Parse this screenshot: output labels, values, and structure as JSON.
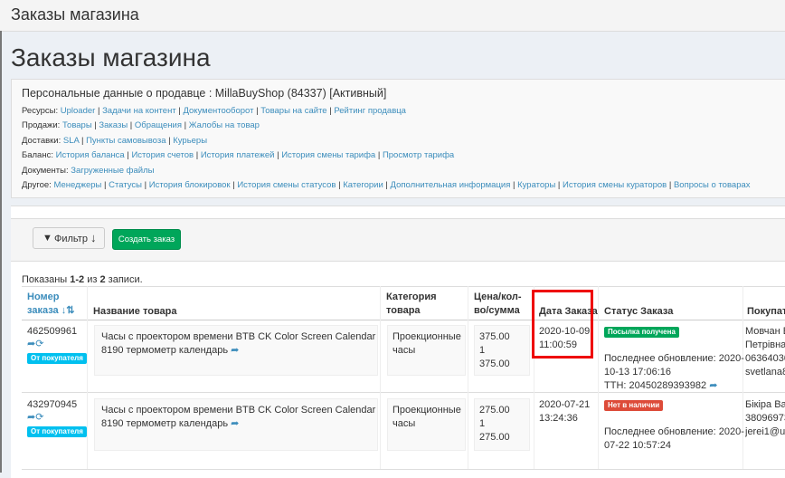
{
  "window": {
    "title": "Заказы магазина"
  },
  "page": {
    "heading": "Заказы магазина"
  },
  "seller": {
    "title": "Персональные данные о продавце : MillaBuyShop (84337) [Активный]"
  },
  "nav": [
    {
      "label": "Ресурсы:",
      "links": [
        "Uploader",
        "Задачи на контент",
        "Документооборот",
        "Товары на сайте",
        "Рейтинг продавца"
      ]
    },
    {
      "label": "Продажи:",
      "links": [
        "Товары",
        "Заказы",
        "Обращения",
        "Жалобы на товар"
      ]
    },
    {
      "label": "Доставки:",
      "links": [
        "SLA",
        "Пункты самовывоза",
        "Курьеры"
      ]
    },
    {
      "label": "Баланс:",
      "links": [
        "История баланса",
        "История счетов",
        "История платежей",
        "История смены тарифа",
        "Просмотр тарифа"
      ]
    },
    {
      "label": "Документы:",
      "links": [
        "Загруженные файлы"
      ]
    },
    {
      "label": "Другое:",
      "links": [
        "Менеджеры",
        "Статусы",
        "История блокировок",
        "История смены статусов",
        "Категории",
        "Дополнительная информация",
        "Кураторы",
        "История смены кураторов",
        "Вопросы о товарах"
      ]
    }
  ],
  "toolbar": {
    "filter_label": "Фильтр",
    "create_label": "Создать заказ"
  },
  "summary": {
    "prefix": "Показаны ",
    "range": "1-2",
    "mid": " из ",
    "total": "2",
    "suffix": " записи."
  },
  "table": {
    "headers": {
      "order_no_1": "Номер",
      "order_no_2": "заказа",
      "product": "Название товара",
      "category_1": "Категория",
      "category_2": "товара",
      "price_1": "Цена/кол-",
      "price_2": "во/сумма",
      "date": "Дата Заказа",
      "status": "Статус Заказа",
      "buyer": "Покупат"
    },
    "rows": [
      {
        "order_no": "462509961",
        "source_badge": "От покупателя",
        "product_1": "Часы с проектором времени BTB CK Color Screen Calendar",
        "product_2": "8190 термометр календарь",
        "category_1": "Проекционные",
        "category_2": "часы",
        "price": "375.00",
        "qty": "1",
        "sum": "375.00",
        "date_1": "2020-10-09",
        "date_2": "11:00:59",
        "status_badge": "Посылка получена",
        "update_1": "Последнее обновление: 2020-",
        "update_2": "10-13 17:06:16",
        "ttn": "ТТН: 20450289393982",
        "buyer_1": "Мовчан В",
        "buyer_2": "Петрівна",
        "buyer_3": "06364030",
        "buyer_4": "svetlana8"
      },
      {
        "order_no": "432970945",
        "source_badge": "От покупателя",
        "product_1": "Часы с проектором времени BTB CK Color Screen Calendar",
        "product_2": "8190 термометр календарь",
        "category_1": "Проекционные",
        "category_2": "часы",
        "price": "275.00",
        "qty": "1",
        "sum": "275.00",
        "date_1": "2020-07-21",
        "date_2": "13:24:36",
        "status_badge": "Нет в наличии",
        "update_1": "Последнее обновление: 2020-",
        "update_2": "07-22 10:57:24",
        "buyer_1": "Бікіра Ва",
        "buyer_2": "38096973",
        "buyer_3": "jerei1@u"
      }
    ]
  },
  "colors": {
    "accent": "#3c8dbc",
    "success": "#00a65a",
    "danger": "#dd4b39",
    "info": "#00c0ef",
    "highlight": "#ee0000"
  }
}
